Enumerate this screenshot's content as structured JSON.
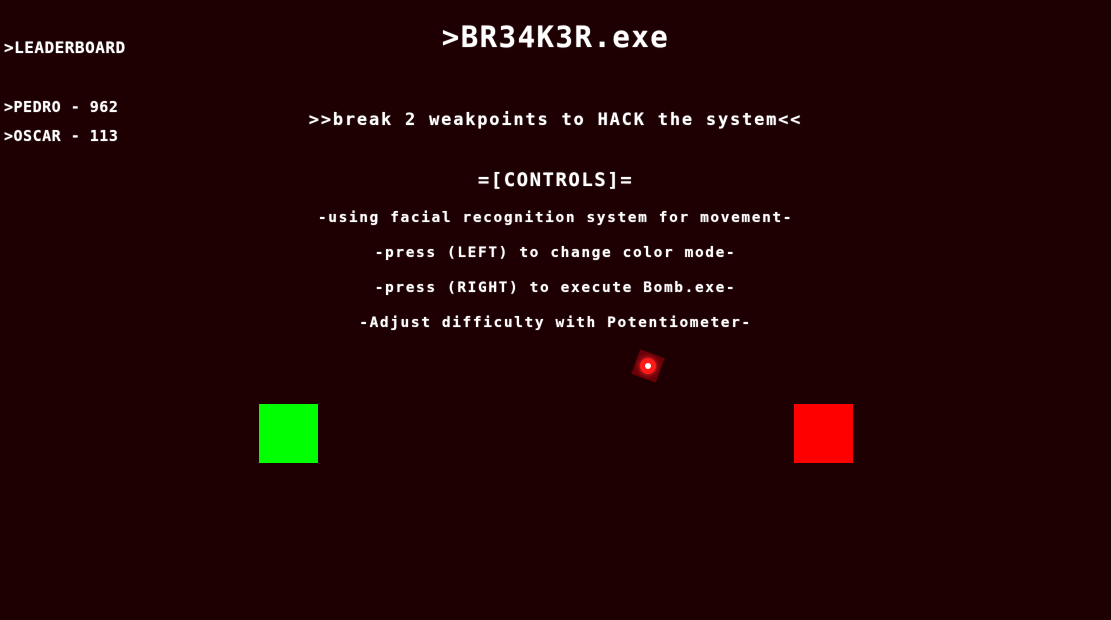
{
  "leaderboard": {
    "title": ">LEADERBOARD",
    "entries": [
      ">PEDRO - 962",
      ">OSCAR - 113"
    ]
  },
  "game": {
    "title": ">BR34K3R.exe",
    "objective": ">>break 2 weakpoints to HACK the system<<"
  },
  "controls": {
    "heading": "=[CONTROLS]=",
    "lines": [
      "-using facial recognition system for movement-",
      "-press (LEFT) to change color mode-",
      "-press (RIGHT) to execute Bomb.exe-",
      "-Adjust difficulty with Potentiometer-"
    ]
  },
  "colors": {
    "background": "#1e0003",
    "weakpoint_left": "#00ff00",
    "weakpoint_right": "#ff0000",
    "ball": "#ff1a1a",
    "text": "#ffffff"
  },
  "weakpoints": [
    {
      "color_name": "green"
    },
    {
      "color_name": "red"
    }
  ]
}
